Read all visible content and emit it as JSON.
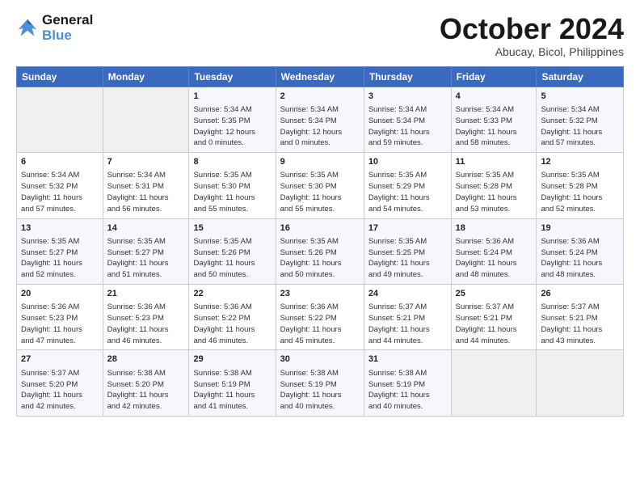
{
  "header": {
    "logo_line1": "General",
    "logo_line2": "Blue",
    "month": "October 2024",
    "location": "Abucay, Bicol, Philippines"
  },
  "days_of_week": [
    "Sunday",
    "Monday",
    "Tuesday",
    "Wednesday",
    "Thursday",
    "Friday",
    "Saturday"
  ],
  "weeks": [
    [
      {
        "day": "",
        "info": ""
      },
      {
        "day": "",
        "info": ""
      },
      {
        "day": "1",
        "info": "Sunrise: 5:34 AM\nSunset: 5:35 PM\nDaylight: 12 hours\nand 0 minutes."
      },
      {
        "day": "2",
        "info": "Sunrise: 5:34 AM\nSunset: 5:34 PM\nDaylight: 12 hours\nand 0 minutes."
      },
      {
        "day": "3",
        "info": "Sunrise: 5:34 AM\nSunset: 5:34 PM\nDaylight: 11 hours\nand 59 minutes."
      },
      {
        "day": "4",
        "info": "Sunrise: 5:34 AM\nSunset: 5:33 PM\nDaylight: 11 hours\nand 58 minutes."
      },
      {
        "day": "5",
        "info": "Sunrise: 5:34 AM\nSunset: 5:32 PM\nDaylight: 11 hours\nand 57 minutes."
      }
    ],
    [
      {
        "day": "6",
        "info": "Sunrise: 5:34 AM\nSunset: 5:32 PM\nDaylight: 11 hours\nand 57 minutes."
      },
      {
        "day": "7",
        "info": "Sunrise: 5:34 AM\nSunset: 5:31 PM\nDaylight: 11 hours\nand 56 minutes."
      },
      {
        "day": "8",
        "info": "Sunrise: 5:35 AM\nSunset: 5:30 PM\nDaylight: 11 hours\nand 55 minutes."
      },
      {
        "day": "9",
        "info": "Sunrise: 5:35 AM\nSunset: 5:30 PM\nDaylight: 11 hours\nand 55 minutes."
      },
      {
        "day": "10",
        "info": "Sunrise: 5:35 AM\nSunset: 5:29 PM\nDaylight: 11 hours\nand 54 minutes."
      },
      {
        "day": "11",
        "info": "Sunrise: 5:35 AM\nSunset: 5:28 PM\nDaylight: 11 hours\nand 53 minutes."
      },
      {
        "day": "12",
        "info": "Sunrise: 5:35 AM\nSunset: 5:28 PM\nDaylight: 11 hours\nand 52 minutes."
      }
    ],
    [
      {
        "day": "13",
        "info": "Sunrise: 5:35 AM\nSunset: 5:27 PM\nDaylight: 11 hours\nand 52 minutes."
      },
      {
        "day": "14",
        "info": "Sunrise: 5:35 AM\nSunset: 5:27 PM\nDaylight: 11 hours\nand 51 minutes."
      },
      {
        "day": "15",
        "info": "Sunrise: 5:35 AM\nSunset: 5:26 PM\nDaylight: 11 hours\nand 50 minutes."
      },
      {
        "day": "16",
        "info": "Sunrise: 5:35 AM\nSunset: 5:26 PM\nDaylight: 11 hours\nand 50 minutes."
      },
      {
        "day": "17",
        "info": "Sunrise: 5:35 AM\nSunset: 5:25 PM\nDaylight: 11 hours\nand 49 minutes."
      },
      {
        "day": "18",
        "info": "Sunrise: 5:36 AM\nSunset: 5:24 PM\nDaylight: 11 hours\nand 48 minutes."
      },
      {
        "day": "19",
        "info": "Sunrise: 5:36 AM\nSunset: 5:24 PM\nDaylight: 11 hours\nand 48 minutes."
      }
    ],
    [
      {
        "day": "20",
        "info": "Sunrise: 5:36 AM\nSunset: 5:23 PM\nDaylight: 11 hours\nand 47 minutes."
      },
      {
        "day": "21",
        "info": "Sunrise: 5:36 AM\nSunset: 5:23 PM\nDaylight: 11 hours\nand 46 minutes."
      },
      {
        "day": "22",
        "info": "Sunrise: 5:36 AM\nSunset: 5:22 PM\nDaylight: 11 hours\nand 46 minutes."
      },
      {
        "day": "23",
        "info": "Sunrise: 5:36 AM\nSunset: 5:22 PM\nDaylight: 11 hours\nand 45 minutes."
      },
      {
        "day": "24",
        "info": "Sunrise: 5:37 AM\nSunset: 5:21 PM\nDaylight: 11 hours\nand 44 minutes."
      },
      {
        "day": "25",
        "info": "Sunrise: 5:37 AM\nSunset: 5:21 PM\nDaylight: 11 hours\nand 44 minutes."
      },
      {
        "day": "26",
        "info": "Sunrise: 5:37 AM\nSunset: 5:21 PM\nDaylight: 11 hours\nand 43 minutes."
      }
    ],
    [
      {
        "day": "27",
        "info": "Sunrise: 5:37 AM\nSunset: 5:20 PM\nDaylight: 11 hours\nand 42 minutes."
      },
      {
        "day": "28",
        "info": "Sunrise: 5:38 AM\nSunset: 5:20 PM\nDaylight: 11 hours\nand 42 minutes."
      },
      {
        "day": "29",
        "info": "Sunrise: 5:38 AM\nSunset: 5:19 PM\nDaylight: 11 hours\nand 41 minutes."
      },
      {
        "day": "30",
        "info": "Sunrise: 5:38 AM\nSunset: 5:19 PM\nDaylight: 11 hours\nand 40 minutes."
      },
      {
        "day": "31",
        "info": "Sunrise: 5:38 AM\nSunset: 5:19 PM\nDaylight: 11 hours\nand 40 minutes."
      },
      {
        "day": "",
        "info": ""
      },
      {
        "day": "",
        "info": ""
      }
    ]
  ]
}
